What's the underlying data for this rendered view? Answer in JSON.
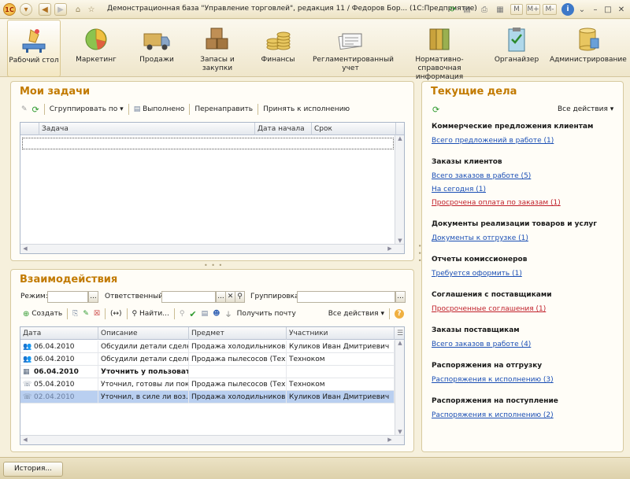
{
  "window": {
    "title": "Демонстрационная база \"Управление торговлей\", редакция 11 / Федоров Бор...  (1С:Предприятие)",
    "mode_buttons": [
      "M",
      "M+",
      "M-"
    ]
  },
  "sections": [
    {
      "label": "Рабочий стол",
      "icon": "desk-icon"
    },
    {
      "label": "Маркетинг",
      "icon": "pie-chart-icon"
    },
    {
      "label": "Продажи",
      "icon": "truck-icon"
    },
    {
      "label": "Запасы и закупки",
      "icon": "boxes-icon"
    },
    {
      "label": "Финансы",
      "icon": "coins-icon"
    },
    {
      "label": "Регламентированный учет",
      "icon": "documents-icon"
    },
    {
      "label": "Нормативно-справочная информация",
      "icon": "binders-icon"
    },
    {
      "label": "Органайзер",
      "icon": "clipboard-icon"
    },
    {
      "label": "Администрирование",
      "icon": "database-icon"
    }
  ],
  "tasks": {
    "title": "Мои задачи",
    "toolbar": {
      "group_by": "Сгруппировать по",
      "done": "Выполнено",
      "redirect": "Перенаправить",
      "accept": "Принять к исполнению"
    },
    "columns": [
      "Задача",
      "Дата начала",
      "Срок"
    ]
  },
  "interactions": {
    "title": "Взаимодействия",
    "filters": {
      "mode_label": "Режим:",
      "responsible_label": "Ответственный:",
      "grouping_label": "Группировка:"
    },
    "toolbar": {
      "create": "Создать",
      "find": "Найти...",
      "get_mail": "Получить почту",
      "all_actions": "Все действия"
    },
    "columns": [
      "Дата",
      "Описание",
      "Предмет",
      "Участники"
    ],
    "rows": [
      {
        "date": "06.04.2010",
        "description": "Обсудили детали сделки",
        "subject": "Продажа холодильников",
        "participants": "Куликов Иван Дмитриевич",
        "icon": "meeting-icon",
        "bold": false,
        "selected": false
      },
      {
        "date": "06.04.2010",
        "description": "Обсудили детали сделки",
        "subject": "Продажа пылесосов (Тех...",
        "participants": "Техноком",
        "icon": "meeting-icon",
        "bold": false,
        "selected": false
      },
      {
        "date": "06.04.2010",
        "description": "Уточнить у пользовате...",
        "subject": "",
        "participants": "",
        "icon": "calendar-icon",
        "bold": true,
        "selected": false
      },
      {
        "date": "05.04.2010",
        "description": "Уточнил, готовы ли пок...",
        "subject": "Продажа пылесосов (Тех...",
        "participants": "Техноком",
        "icon": "phone-call-icon",
        "bold": false,
        "selected": false
      },
      {
        "date": "02.04.2010",
        "description": "Уточнил, в силе ли воз...",
        "subject": "Продажа холодильников",
        "participants": "Куликов Иван Дмитриевич",
        "icon": "phone-call-icon",
        "bold": false,
        "selected": true
      }
    ]
  },
  "current": {
    "title": "Текущие дела",
    "all_actions": "Все действия",
    "groups": [
      {
        "title": "Коммерческие предложения клиентам",
        "links": [
          {
            "text": "Всего предложений в работе (1)",
            "red": false
          }
        ]
      },
      {
        "title": "Заказы клиентов",
        "links": [
          {
            "text": "Всего заказов в работе (5)",
            "red": false
          },
          {
            "text": "На сегодня (1)",
            "red": false
          },
          {
            "text": "Просрочена оплата по заказам (1)",
            "red": true
          }
        ]
      },
      {
        "title": "Документы реализации товаров и услуг",
        "links": [
          {
            "text": "Документы к отгрузке (1)",
            "red": false
          }
        ]
      },
      {
        "title": "Отчеты комиссионеров",
        "links": [
          {
            "text": "Требуется оформить (1)",
            "red": false
          }
        ]
      },
      {
        "title": "Соглашения с поставщиками",
        "links": [
          {
            "text": "Просроченные соглашения (1)",
            "red": true
          }
        ]
      },
      {
        "title": "Заказы поставщикам",
        "links": [
          {
            "text": "Всего заказов в работе (4)",
            "red": false
          }
        ]
      },
      {
        "title": "Распоряжения на отгрузку",
        "links": [
          {
            "text": "Распоряжения к исполнению (3)",
            "red": false
          }
        ]
      },
      {
        "title": "Распоряжения на поступление",
        "links": [
          {
            "text": "Распоряжения к исполнению (2)",
            "red": false
          }
        ]
      }
    ]
  },
  "status": {
    "history_button": "История..."
  }
}
